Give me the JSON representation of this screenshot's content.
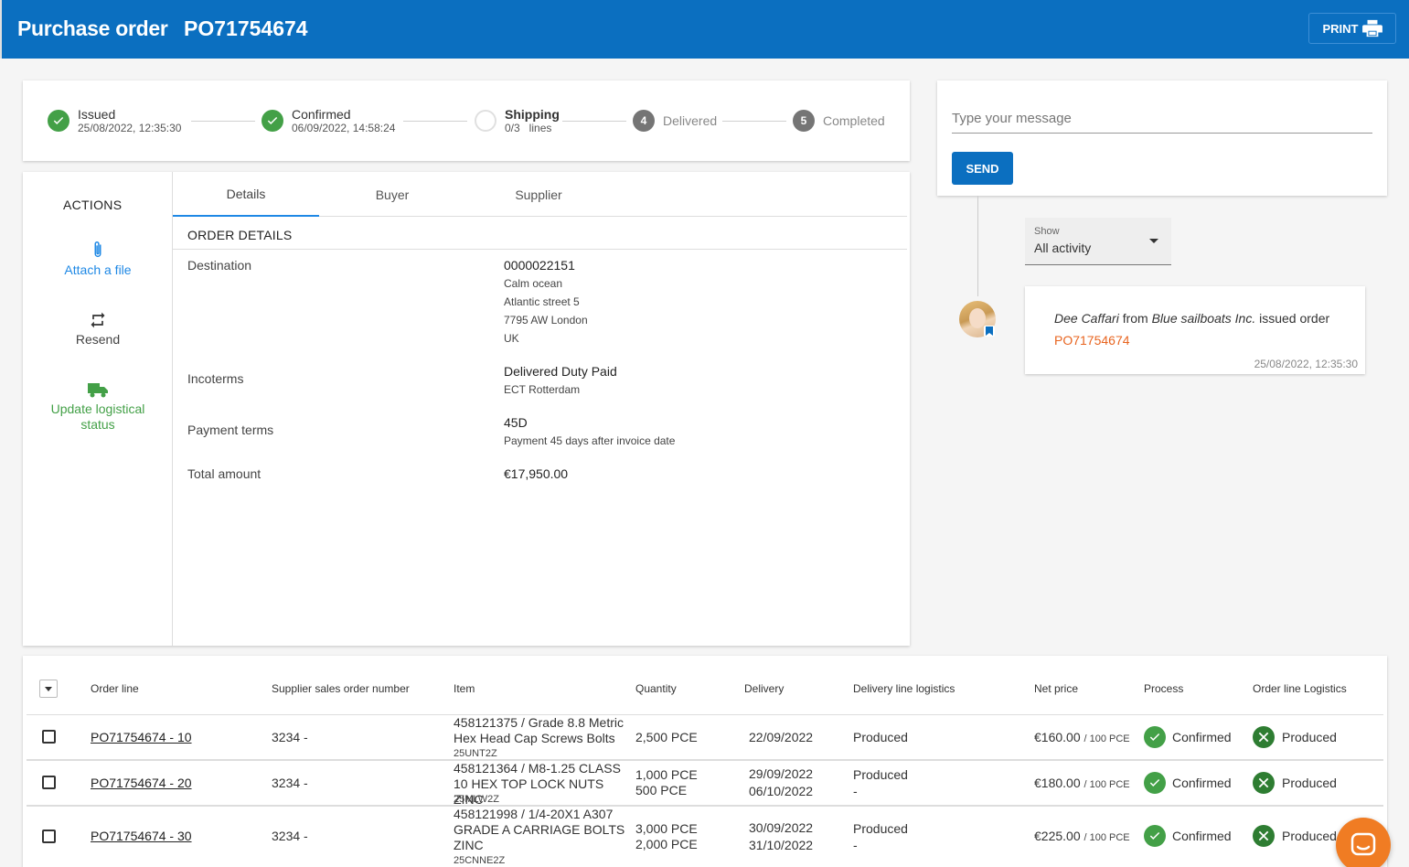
{
  "header": {
    "title": "Purchase order",
    "po_number": "PO71754674",
    "print_label": "PRINT"
  },
  "stepper": {
    "steps": [
      {
        "label": "Issued",
        "sub": "25/08/2022, 12:35:30",
        "state": "done"
      },
      {
        "label": "Confirmed",
        "sub": "06/09/2022, 14:58:24",
        "state": "done"
      },
      {
        "label": "Shipping",
        "sub": "0/3   lines",
        "state": "current"
      },
      {
        "label": "Delivered",
        "number": "4",
        "state": "pending"
      },
      {
        "label": "Completed",
        "number": "5",
        "state": "pending"
      }
    ]
  },
  "actions": {
    "title": "ACTIONS",
    "attach": "Attach a file",
    "resend": "Resend",
    "update": "Update logistical status"
  },
  "tabs": [
    "Details",
    "Buyer",
    "Supplier"
  ],
  "details": {
    "section_title": "ORDER DETAILS",
    "destination_label": "Destination",
    "destination": {
      "code": "0000022151",
      "name": "Calm ocean",
      "street": "Atlantic street 5",
      "city": "7795 AW London",
      "country": "UK"
    },
    "incoterms_label": "Incoterms",
    "incoterms": {
      "value": "Delivered Duty Paid",
      "sub": "ECT Rotterdam"
    },
    "payment_label": "Payment terms",
    "payment": {
      "value": "45D",
      "sub": "Payment 45 days after invoice date"
    },
    "total_label": "Total amount",
    "total": "€17,950.00"
  },
  "chat": {
    "placeholder": "Type your message",
    "send_label": "SEND",
    "show_label": "Show",
    "show_value": "All activity"
  },
  "activity": {
    "user": "Dee Caffari",
    "from": "from",
    "company": "Blue sailboats Inc.",
    "action": "issued order",
    "link": "PO71754674",
    "timestamp": "25/08/2022, 12:35:30"
  },
  "table": {
    "columns": [
      "Order line",
      "Supplier sales order number",
      "Item",
      "Quantity",
      "Delivery",
      "Delivery line logistics",
      "Net price",
      "Process",
      "Order line Logistics"
    ],
    "rows": [
      {
        "order_line": "PO71754674 - 10",
        "supplier_so": "3234 -",
        "item": "458121375 / Grade 8.8 Metric Hex Head Cap Screws Bolts",
        "item_code": "25UNT2Z",
        "qty1": "2,500 PCE",
        "qty2": "",
        "delivery1": "22/09/2022",
        "delivery2": "",
        "dll1": "Produced",
        "dll2": "",
        "price": "€160.00",
        "price_unit": "/ 100 PCE",
        "process": "Confirmed",
        "logistics": "Produced"
      },
      {
        "order_line": "PO71754674 - 20",
        "supplier_so": "3234 -",
        "item": "458121364 / M8-1.25 CLASS 10 HEX TOP LOCK NUTS ZINC",
        "item_code": "25MLW2Z",
        "qty1": "1,000 PCE",
        "qty2": "500 PCE",
        "delivery1": "29/09/2022",
        "delivery2": "06/10/2022",
        "dll1": "Produced",
        "dll2": "-",
        "price": "€180.00",
        "price_unit": "/ 100 PCE",
        "process": "Confirmed",
        "logistics": "Produced"
      },
      {
        "order_line": "PO71754674 - 30",
        "supplier_so": "3234 -",
        "item": "458121998 / 1/4-20X1 A307 GRADE A CARRIAGE BOLTS ZINC",
        "item_code": "25CNNE2Z",
        "qty1": "3,000 PCE",
        "qty2": "2,000 PCE",
        "delivery1": "30/09/2022",
        "delivery2": "31/10/2022",
        "dll1": "Produced",
        "dll2": "-",
        "price": "€225.00",
        "price_unit": "/ 100 PCE",
        "process": "Confirmed",
        "logistics": "Produced"
      }
    ]
  },
  "colors": {
    "primary": "#0b6fc0",
    "success": "#43a047",
    "link_orange": "#e8641f",
    "fab": "#f07c23"
  }
}
